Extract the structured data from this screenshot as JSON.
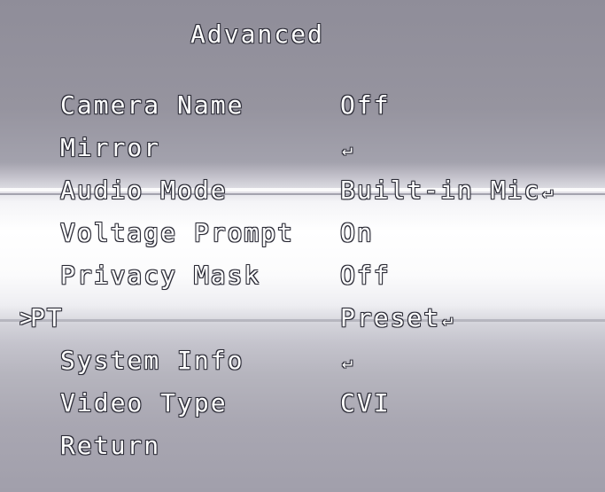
{
  "title": "Advanced",
  "cursor_symbol": ">",
  "enter_symbol": "↵",
  "items": [
    {
      "label": "Camera Name",
      "value": "Off",
      "enter": ""
    },
    {
      "label": "Mirror",
      "value": "",
      "enter": "↵"
    },
    {
      "label": "Audio Mode",
      "value": "Built-in Mic",
      "enter": "↵"
    },
    {
      "label": "Voltage Prompt",
      "value": "On",
      "enter": ""
    },
    {
      "label": "Privacy Mask",
      "value": "Off",
      "enter": ""
    },
    {
      "label": "PT",
      "value": "Preset",
      "enter": "↵"
    },
    {
      "label": "System Info",
      "value": "",
      "enter": "↵"
    },
    {
      "label": "Video Type",
      "value": "CVI",
      "enter": ""
    },
    {
      "label": "Return",
      "value": "",
      "enter": ""
    }
  ],
  "selected_index": 5
}
